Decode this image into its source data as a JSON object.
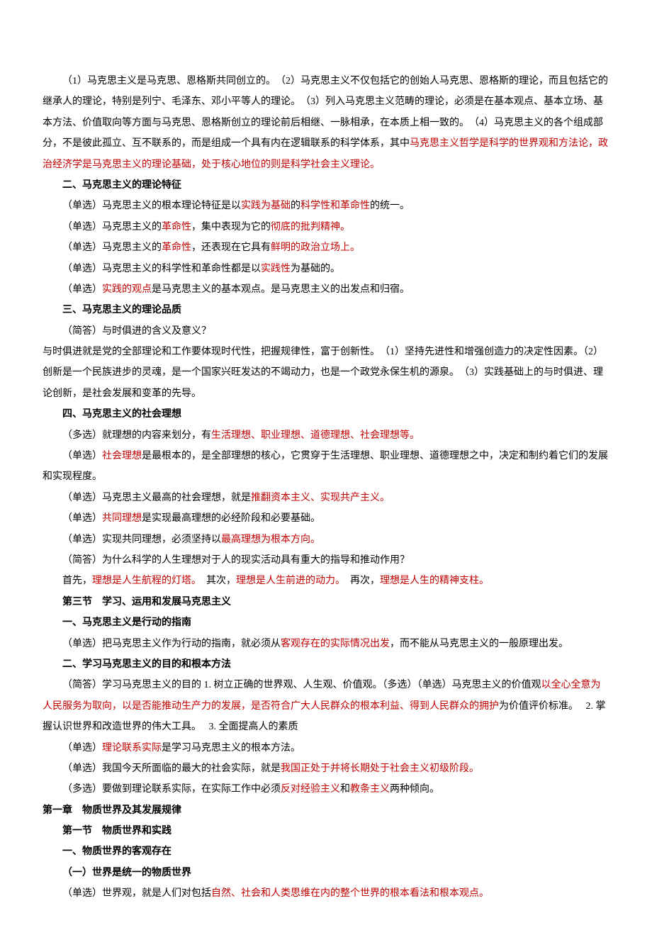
{
  "p1": {
    "t1": "（1）马克思主义是马克思、恩格斯共同创立的。　（2）马克思主义不仅包括它的创始人马克思、恩格斯的理论，而且包括它的继承人的理论，特别是列宁、毛泽东、邓小平等人的理论。　（3）列入马克思主义范畴的理论，必须是在基本观点、基本立场、基本方法、价值取向等方面与马克思、恩格斯创立的理论前后相继、一脉相承，在本质上相一致的。　（4）马克思主义的各个组成部分，不是彼此孤立、互不联系的，而是组成一个具有内在逻辑联系的科学体系，其中",
    "r1": "马克思主义哲学是科学的世界观和方法论，政治经济学是马克思主义的理论基础，处于核心地位的则是科学社会主义理论。"
  },
  "h2": "二、马克思主义的理论特征",
  "p2a": "（单选）马克思主义的根本理论特征是以",
  "p2b": "实践为基础",
  "p2c": "的",
  "p2d": "科学性和革命性",
  "p2e": "的统一。",
  "p3a": "（单选）马克思主义的",
  "p3b": "革命性",
  "p3c": "，集中表现为它的",
  "p3d": "彻底的批判精神。",
  "p4a": "（单选）马克思主义的",
  "p4b": "革命性",
  "p4c": "，还表现在它具有",
  "p4d": "鲜明的政治立场上。",
  "p5a": "（单选）马克思主义的科学性和革命性都是以",
  "p5b": "实践性",
  "p5c": "为基础的。",
  "p6a": "（单选）",
  "p6b": "实践的观点",
  "p6c": "是马克思主义的基本观点。是马克思主义的出发点和归宿。",
  "h3": "三、马克思主义的理论品质",
  "p7": "（简答）与时俱进的含义及意义？",
  "p8": "与时俱进就是党的全部理论和工作要体现时代性，把握规律性，富于创新性。　（1）坚持先进性和增强创造力的决定性因素。（2）创新是一个民族进步的灵魂，是一个国家兴旺发达的不竭动力，也是一个政党永保生机的源泉。　（3）实践基础上的与时俱进、理论创新，是社会发展和变革的先导。",
  "h4": "四、马克思主义的社会理想",
  "p9a": "（多选）就理想的内容来划分，有",
  "p9b": "生活理想、职业理想、道德理想、社会理想等。",
  "p10a": "（单选）",
  "p10b": "社会理想",
  "p10c": "是最根本的，是全部理想的核心，它贯穿于生活理想、职业理想、道德理想之中，决定和制约着它们的发展和实现程度。",
  "p11a": "（单选）马克思主义最高的社会理想，就是",
  "p11b": "推翻资本主义、实现共产主义。",
  "p12a": "（单选）",
  "p12b": "共同理想",
  "p12c": "是实现最高理想的必经阶段和必要基础。",
  "p13a": "（单选）实现共同理想，必须坚持以",
  "p13b": "最高理想为根本方向。",
  "p14": "（简答）为什么科学的人生理想对于人的现实活动具有重大的指导和推动作用？",
  "p15a": "首先，",
  "p15b": "理想是人生航程的灯塔。",
  "p15c": "　其次，",
  "p15d": "理想是人生前进的动力。",
  "p15e": "　再次，",
  "p15f": "理想是人生的精神支柱。",
  "h5": "第三节　学习、运用和发展马克思主义",
  "h6": "一、马克思主义是行动的指南",
  "p16a": "（单选）把马克思主义作为行动的指南，就必须从",
  "p16b": "客观存在的实际情况出发",
  "p16c": "，而不能从马克思主义的一般原理出发。",
  "h7": "二、学习马克思主义的目的和根本方法",
  "p17a": "（简答）学习马克思主义的目的 1. 树立正确的世界观、人生观、价值观。（多选）（单选）马克思主义的价值观",
  "p17b": "以全心全意为人民服务为取向，以是否能推动生产力的发展，是否符合广大人民群众的根本利益、得到人民群众的拥护",
  "p17c": "为价值评价标准。　 2. 掌握认识世界和改造世界的伟大工具。　 3. 全面提高人的素质",
  "p18a": "（单选）",
  "p18b": "理论联系实际",
  "p18c": "是学习马克思主义的根本方法。",
  "p19a": "（单选）我国今天所面临的最大的社会实际，就是",
  "p19b": "我国正处于并将长期处于社会主义初级阶段。",
  "p20a": "（多选）要做到理论联系实际，在实际工作中必须",
  "p20b": "反对经验主义",
  "p20c": "和",
  "p20d": "教条主义",
  "p20e": "两种倾向。",
  "h8": "第一章　物质世界及其发展规律",
  "h9": "第一节　物质世界和实践",
  "h10": "一、物质世界的客观存在",
  "h11": "（一）世界是统一的物质世界",
  "p21a": "（单选）世界观，就是人们对包括",
  "p21b": "自然、社会和人类思维在内的整个世界的根本看法和根本观点。"
}
